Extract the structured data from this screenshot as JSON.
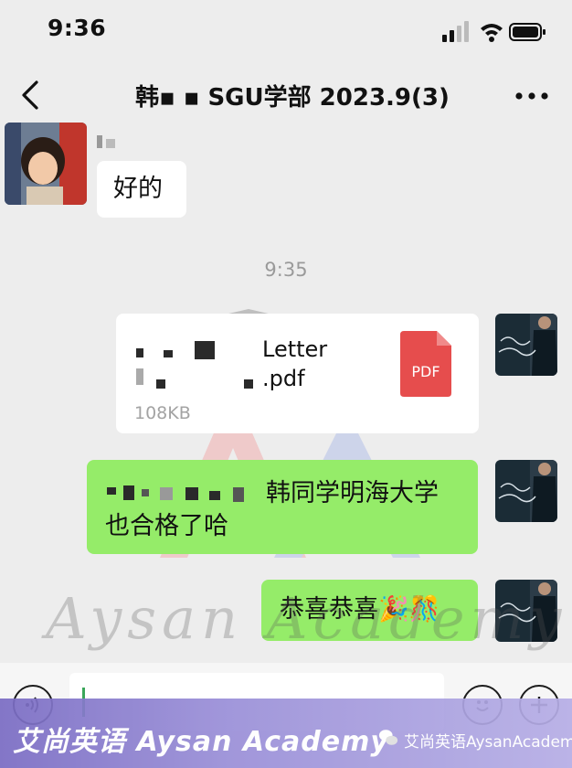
{
  "status": {
    "time": "9:36"
  },
  "nav": {
    "title": "韩▪ ▪  SGU学部 2023.9(3)"
  },
  "messages": {
    "reply": "好的",
    "timestamp": "9:35",
    "file": {
      "name_line1": "Letter",
      "name_line2": ".pdf",
      "size": "108KB",
      "type_label": "PDF"
    },
    "text1_line1": "韩同学明海大学",
    "text1_line2": "也合格了哈",
    "text2": "恭喜恭喜🎉🎊"
  },
  "watermark": {
    "script": "Aysan Academy"
  },
  "banner": {
    "left": "艾尚英语 Aysan Academy",
    "right": "艾尚英语AysanAcademy"
  },
  "colors": {
    "sent_bubble": "#95ec69",
    "pdf_icon": "#e64d4d",
    "background": "#ededed"
  }
}
